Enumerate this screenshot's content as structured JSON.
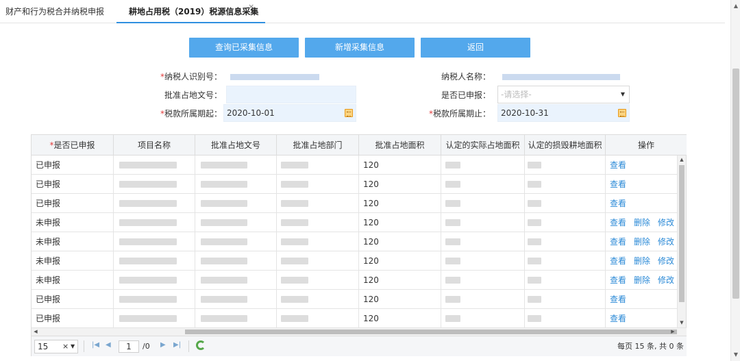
{
  "tabs": [
    {
      "label": "财产和行为税合并纳税申报"
    },
    {
      "label": "耕地占用税（2019）税源信息采集",
      "close": "×"
    }
  ],
  "buttons": {
    "query": "查询已采集信息",
    "add": "新增采集信息",
    "back": "返回"
  },
  "form": {
    "taxpayer_id_label": "纳税人识别号：",
    "taxpayer_name_label": "纳税人名称：",
    "approval_doc_label": "批准占地文号：",
    "declared_label": "是否已申报：",
    "declared_placeholder": "-请选择-",
    "period_start_label": "税款所属期起：",
    "period_start_value": "2020-10-01",
    "period_end_label": "税款所属期止：",
    "period_end_value": "2020-10-31",
    "required_mark": "*"
  },
  "grid": {
    "headers": [
      "是否已申报",
      "项目名称",
      "批准占地文号",
      "批准占地部门",
      "批准占地面积",
      "认定的实际占地面积",
      "认定的损毁耕地面积",
      "操作"
    ],
    "rows": [
      {
        "status": "已申报",
        "area": "120",
        "actions": [
          "查看"
        ]
      },
      {
        "status": "已申报",
        "area": "120",
        "actions": [
          "查看"
        ]
      },
      {
        "status": "已申报",
        "area": "120",
        "actions": [
          "查看"
        ]
      },
      {
        "status": "未申报",
        "area": "120",
        "actions": [
          "查看",
          "删除",
          "修改"
        ]
      },
      {
        "status": "未申报",
        "area": "120",
        "actions": [
          "查看",
          "删除",
          "修改"
        ]
      },
      {
        "status": "未申报",
        "area": "120",
        "actions": [
          "查看",
          "删除",
          "修改"
        ]
      },
      {
        "status": "未申报",
        "area": "120",
        "actions": [
          "查看",
          "删除",
          "修改"
        ]
      },
      {
        "status": "已申报",
        "area": "120",
        "actions": [
          "查看"
        ]
      },
      {
        "status": "已申报",
        "area": "120",
        "actions": [
          "查看"
        ]
      }
    ]
  },
  "pager": {
    "page_size": "15",
    "page_input": "1",
    "page_total": "/0",
    "summary": "每页 15 条, 共 0 条"
  },
  "colors": {
    "primary": "#53a8ec",
    "link": "#2b8ad7",
    "required": "#e23c3c"
  }
}
